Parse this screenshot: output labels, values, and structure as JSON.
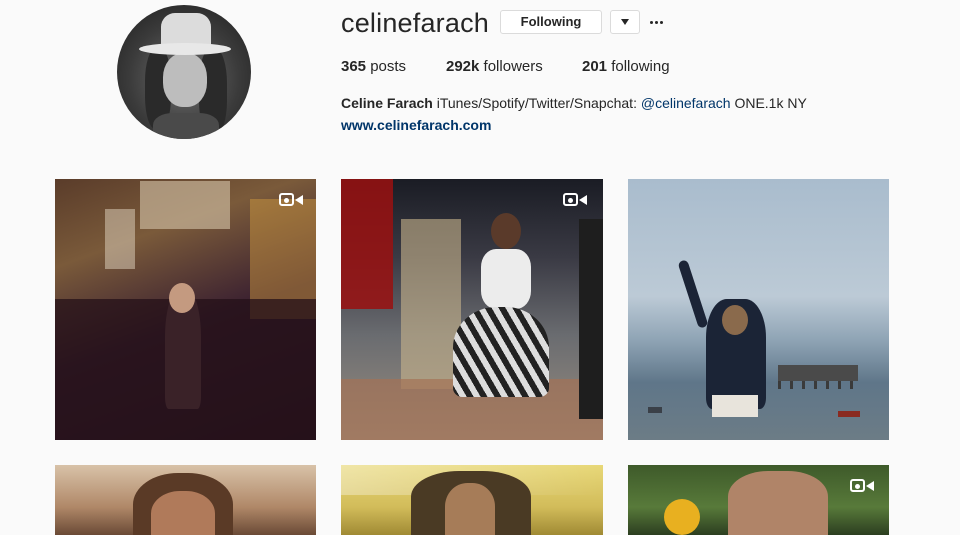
{
  "profile": {
    "username": "celinefarach",
    "following_button": "Following",
    "stats": {
      "posts_count": "365",
      "posts_label": "posts",
      "followers_count": "292k",
      "followers_label": "followers",
      "following_count": "201",
      "following_label": "following"
    },
    "bio": {
      "name": "Celine Farach",
      "text": "iTunes/Spotify/Twitter/Snapchat:",
      "mention": "@celinefarach",
      "text_after": "ONE.1k NY"
    },
    "website": "www.celinefarach.com"
  },
  "icons": {
    "dropdown": "chevron-down-icon",
    "more": "more-options-icon",
    "video": "video-icon"
  },
  "colors": {
    "link": "#003569",
    "background": "#fafafa",
    "border": "#dbdbdb"
  },
  "posts": [
    {
      "type": "video"
    },
    {
      "type": "video"
    },
    {
      "type": "photo"
    },
    {
      "type": "photo"
    },
    {
      "type": "photo"
    },
    {
      "type": "video"
    }
  ]
}
